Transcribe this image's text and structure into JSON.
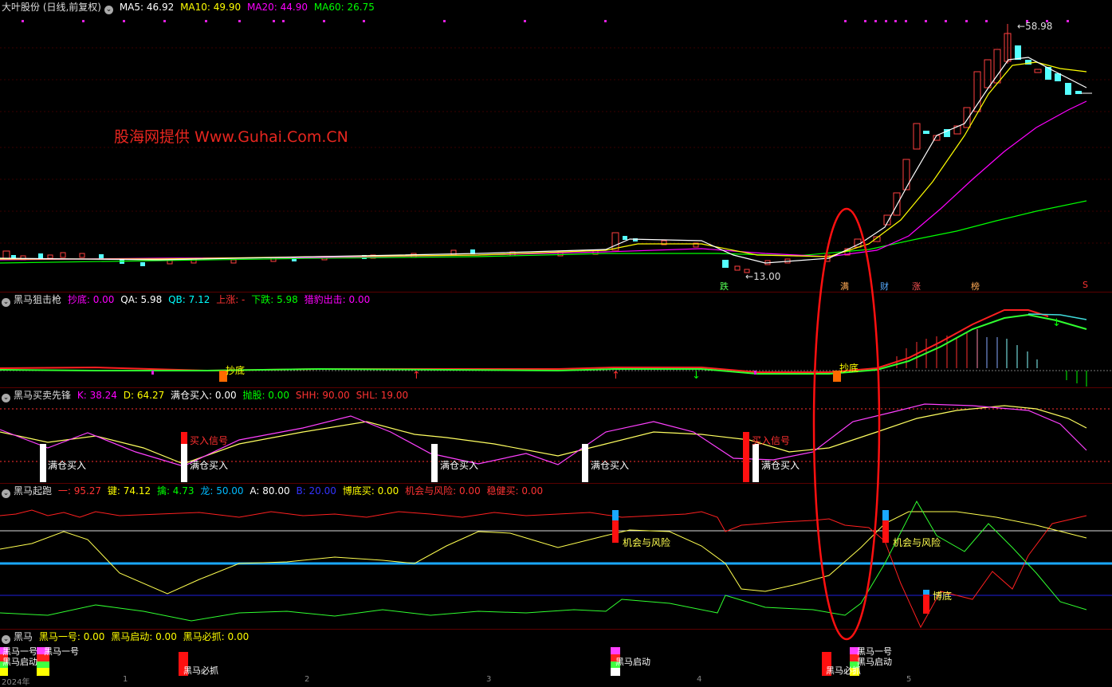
{
  "main": {
    "stock": "大叶股份 (日线,前复权)",
    "ma": [
      {
        "label": "MA5: 46.92",
        "color": "#ffffff"
      },
      {
        "label": "MA10: 49.90",
        "color": "#ffff00"
      },
      {
        "label": "MA20: 44.90",
        "color": "#ff00ff"
      },
      {
        "label": "MA60: 26.75",
        "color": "#00ff00"
      }
    ],
    "high_label": "58.98",
    "low_label": "13.00",
    "watermark": "股海网提供 Www.Guhai.Com.CN",
    "event_tags": [
      "跌",
      "满",
      "财",
      "涨",
      "榜",
      "S"
    ]
  },
  "panel1": {
    "title": "黑马狙击枪",
    "params": [
      {
        "label": "抄底: 0.00",
        "color": "#ff00ff"
      },
      {
        "label": "QA: 5.98",
        "color": "#ffffff"
      },
      {
        "label": "QB: 7.12",
        "color": "#00ffff"
      },
      {
        "label": "上涨: -",
        "color": "#ff3030"
      },
      {
        "label": "下跌: 5.98",
        "color": "#00ff00"
      },
      {
        "label": "猎豹出击: 0.00",
        "color": "#ff00ff"
      }
    ],
    "signals": [
      "抄底",
      "抄底"
    ]
  },
  "panel2": {
    "title": "黑马买卖先锋",
    "params": [
      {
        "label": "K: 38.24",
        "color": "#ff00ff"
      },
      {
        "label": "D: 64.27",
        "color": "#ffff00"
      },
      {
        "label": "满仓买入: 0.00",
        "color": "#ffffff"
      },
      {
        "label": "抛股: 0.00",
        "color": "#00ff00"
      },
      {
        "label": "SHH: 90.00",
        "color": "#ff3030"
      },
      {
        "label": "SHL: 19.00",
        "color": "#ff3030"
      }
    ],
    "buy_full": [
      "满仓买入",
      "满仓买入",
      "满仓买入",
      "满仓买入",
      "满仓买入"
    ],
    "buy_signal": [
      "买入信号",
      "买入信号"
    ]
  },
  "panel3": {
    "title": "黑马起跑",
    "params": [
      {
        "label": "一: 95.27",
        "color": "#ff3030"
      },
      {
        "label": "键: 74.12",
        "color": "#ffff00"
      },
      {
        "label": "擒: 4.73",
        "color": "#00ff00"
      },
      {
        "label": "龙: 50.00",
        "color": "#00bfff"
      },
      {
        "label": "A: 80.00",
        "color": "#ffffff"
      },
      {
        "label": "B: 20.00",
        "color": "#3333ff"
      },
      {
        "label": "博底买: 0.00",
        "color": "#ffff00"
      },
      {
        "label": "机会与风险: 0.00",
        "color": "#ff3030"
      },
      {
        "label": "稳健买: 0.00",
        "color": "#ff3030"
      }
    ],
    "signals": [
      "机会与风险",
      "机会与风险",
      "博底"
    ]
  },
  "panel4": {
    "title": "黑马",
    "params": [
      {
        "label": "黑马一号: 0.00",
        "color": "#ffff00"
      },
      {
        "label": "黑马启动: 0.00",
        "color": "#ffff00"
      },
      {
        "label": "黑马必抓: 0.00",
        "color": "#ffff00"
      }
    ],
    "signals": [
      "黑马一号",
      "黑马一号",
      "黑马启动",
      "黑马必抓",
      "黑马启动",
      "黑马必抓",
      "黑马一号",
      "黑马启动"
    ]
  },
  "xaxis": {
    "labels": [
      "2024年",
      "1",
      "2",
      "3",
      "4",
      "5"
    ]
  }
}
